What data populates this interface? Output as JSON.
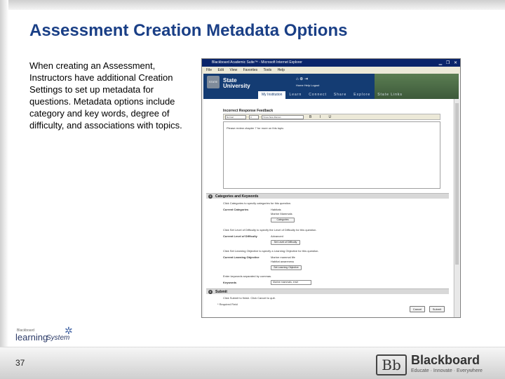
{
  "slide": {
    "title": "Assessment Creation Metadata Options",
    "body": "When creating an Assessment, Instructors have additional Creation Settings to set up metadata for questions. Metadata options include category and key words, degree of difficulty, and associations with topics.",
    "page_number": "37"
  },
  "logos": {
    "learning_small": "Blackboard",
    "learning_word": "learning",
    "learning_system": "System",
    "bb_mark": "Bb",
    "bb_name": "Blackboard",
    "bb_tagline": "Educate · Innovate · Everywhere"
  },
  "window": {
    "title": "Blackboard Academic Suite™ - Microsoft Internet Explorer",
    "menu": [
      "File",
      "Edit",
      "View",
      "Favorites",
      "Tools",
      "Help"
    ]
  },
  "banner": {
    "shield": "STATE",
    "univ_line1": "State",
    "univ_line2": "University",
    "icon_labels": "Home   Help   Logout",
    "tabs": [
      "My Institution",
      "Learn",
      "Connect",
      "Share",
      "Explore",
      "State Links"
    ]
  },
  "editor": {
    "label": "Incorrect Response Feedback",
    "style_select": "Normal",
    "size_select": "3",
    "font_select": "Times New Roman",
    "format_buttons": "B I U",
    "text": "Please review chapter 7 for more on this topic."
  },
  "categories": {
    "section_num": "5",
    "section_title": "Categories and Keywords",
    "instruction": "Click Categories to specify categories for this question.",
    "current_categories_label": "Current Categories",
    "current_categories": [
      "Habitats",
      "Marine Mammals"
    ],
    "categories_button": "Categories",
    "difficulty_instruction": "Click Set Level of Difficulty to specify the Level of Difficulty for this question.",
    "difficulty_label": "Current Level of Difficulty",
    "difficulty_value": "Advanced",
    "difficulty_button": "Set Level of Difficulty",
    "objective_instruction": "Click Set Learning Objective to specify a Learning Objective for this question.",
    "objective_label": "Current Learning Objective",
    "objectives": [
      "Marine mammal life",
      "Habitat awareness"
    ],
    "objective_button": "Set Learning Objective",
    "keywords_instruction": "Enter keywords separated by commas.",
    "keywords_label": "Keywords",
    "keywords_value": "Marine mammals, envir"
  },
  "submit": {
    "section_num": "6",
    "section_title": "Submit",
    "instruction": "Click Submit to finish. Click Cancel to quit.",
    "required": "* Required Field",
    "cancel_button": "Cancel",
    "submit_button": "Submit"
  }
}
